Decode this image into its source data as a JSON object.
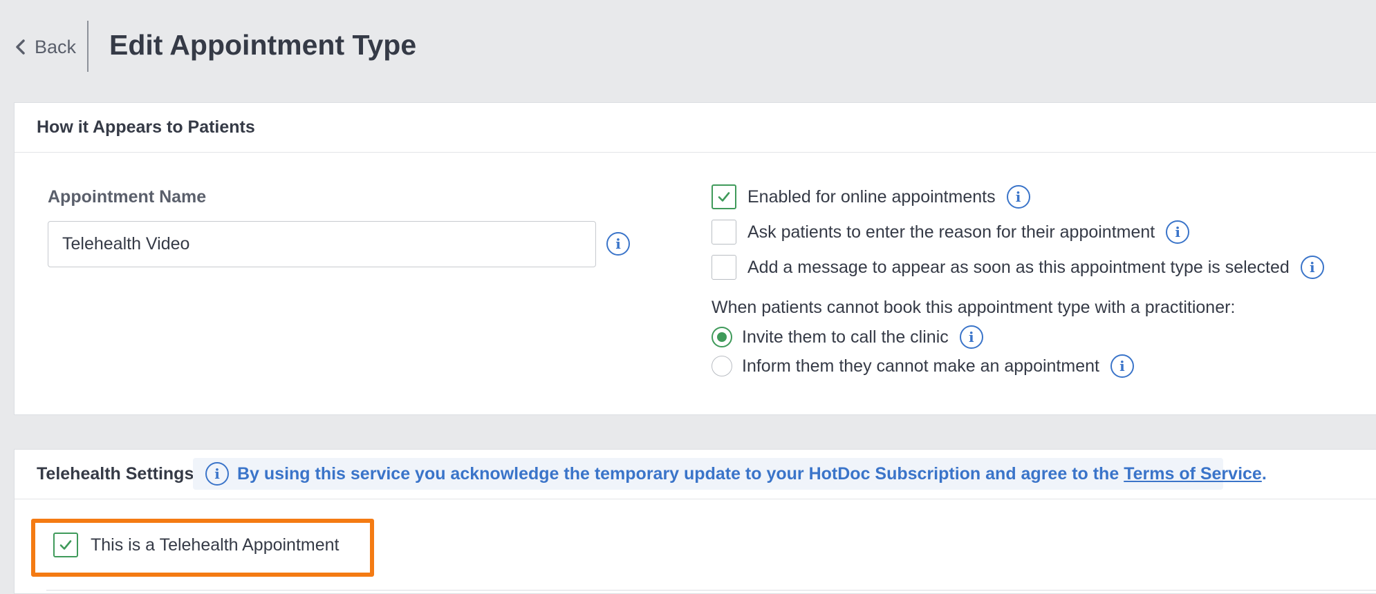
{
  "header": {
    "back_label": "Back",
    "title": "Edit Appointment Type"
  },
  "appearance_card": {
    "title": "How it Appears to Patients",
    "name_field": {
      "label": "Appointment Name",
      "value": "Telehealth Video"
    },
    "options": [
      {
        "label": "Enabled for online appointments",
        "checked": true
      },
      {
        "label": "Ask patients to enter the reason for their appointment",
        "checked": false
      },
      {
        "label": "Add a message to appear as soon as this appointment type is selected",
        "checked": false
      }
    ],
    "unavailable_prompt": "When patients cannot book this appointment type with a practitioner:",
    "unavailable_choices": [
      {
        "label": "Invite them to call the clinic",
        "selected": true
      },
      {
        "label": "Inform them they cannot make an appointment",
        "selected": false
      }
    ]
  },
  "telehealth_card": {
    "title": "Telehealth Settings",
    "notice_text": "By using this service you acknowledge the temporary update to your HotDoc Subscription and agree to the",
    "notice_link": "Terms of Service",
    "notice_end": ".",
    "telehealth_checkbox": {
      "label": "This is a Telehealth Appointment",
      "checked": true
    }
  },
  "colors": {
    "accent_blue": "#3a74c9",
    "check_green": "#3f9a5a",
    "highlight_orange": "#f47b13",
    "page_bg": "#e8e9eb"
  },
  "icons": {
    "back": "chevron-left-icon",
    "info": "info-icon",
    "check": "check-icon"
  }
}
